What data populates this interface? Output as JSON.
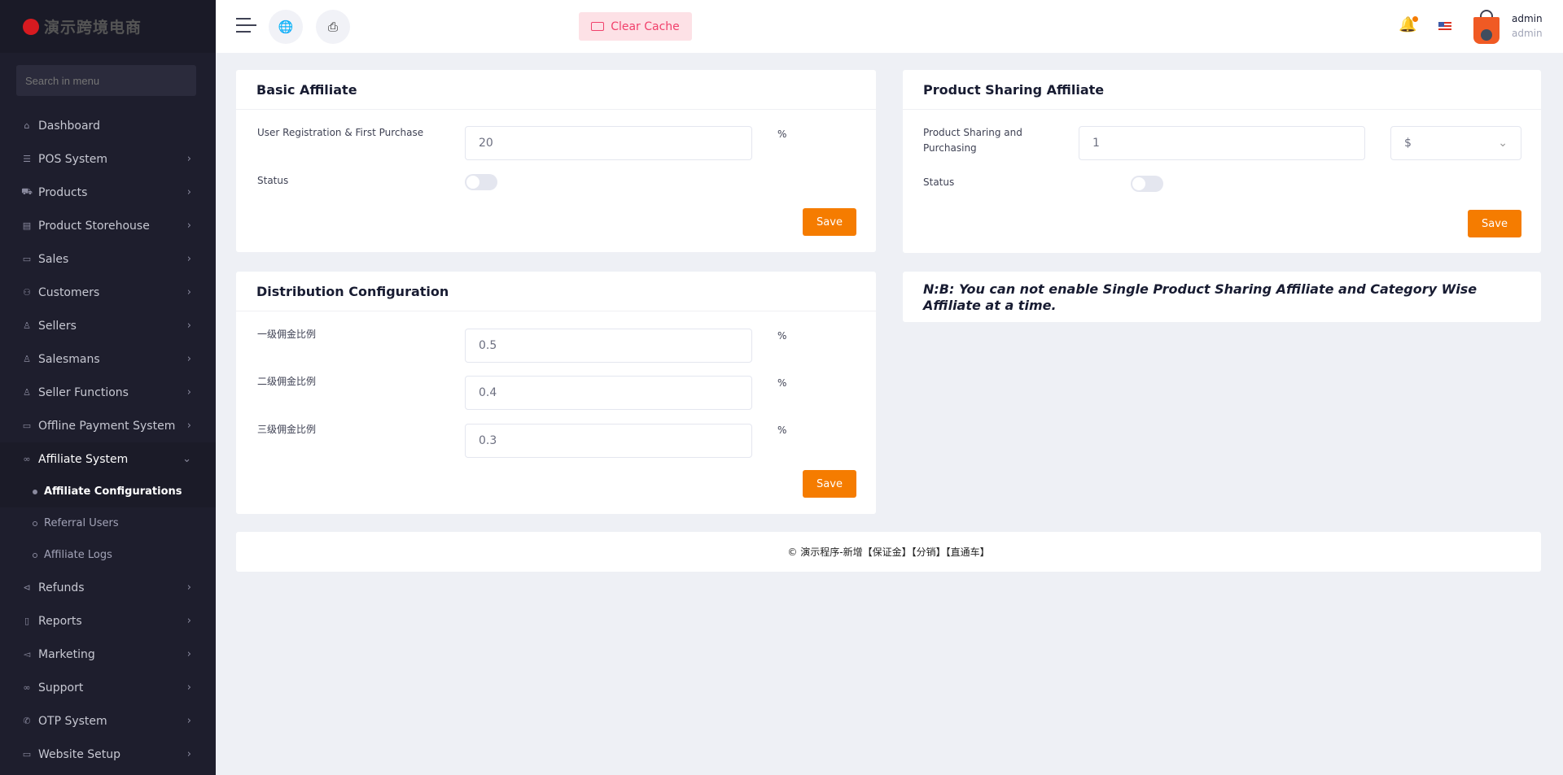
{
  "logo": {
    "text": "演示跨境电商"
  },
  "sidebar": {
    "search_placeholder": "Search in menu",
    "items": [
      {
        "label": "Dashboard"
      },
      {
        "label": "POS System"
      },
      {
        "label": "Products"
      },
      {
        "label": "Product Storehouse"
      },
      {
        "label": "Sales"
      },
      {
        "label": "Customers"
      },
      {
        "label": "Sellers"
      },
      {
        "label": "Salesmans"
      },
      {
        "label": "Seller Functions"
      },
      {
        "label": "Offline Payment System"
      },
      {
        "label": "Affiliate System"
      }
    ],
    "sub": [
      {
        "label": "Affiliate Configurations"
      },
      {
        "label": "Referral Users"
      },
      {
        "label": "Affiliate Logs"
      }
    ],
    "items2": [
      {
        "label": "Refunds"
      },
      {
        "label": "Reports"
      },
      {
        "label": "Marketing"
      },
      {
        "label": "Support"
      },
      {
        "label": "OTP System"
      },
      {
        "label": "Website Setup"
      }
    ]
  },
  "header": {
    "clear_cache": "Clear Cache",
    "user_name": "admin",
    "user_role": "admin"
  },
  "basic": {
    "title": "Basic Affiliate",
    "label": "User Registration & First Purchase",
    "value": "20",
    "unit": "%",
    "status": "Status",
    "status_on": false,
    "save": "Save"
  },
  "product": {
    "title": "Product Sharing Affiliate",
    "label": "Product Sharing and Purchasing",
    "value": "1",
    "currency": "$",
    "status": "Status",
    "status_on": false,
    "save": "Save"
  },
  "distribution": {
    "title": "Distribution Configuration",
    "rows": [
      {
        "label": "一级佣金比例",
        "value": "0.5",
        "unit": "%"
      },
      {
        "label": "二级佣金比例",
        "value": "0.4",
        "unit": "%"
      },
      {
        "label": "三级佣金比例",
        "value": "0.3",
        "unit": "%"
      }
    ],
    "save": "Save"
  },
  "note": "N:B: You can not enable Single Product Sharing Affiliate and Category Wise Affiliate at a time.",
  "footer": "© 演示程序-新增【保证金】【分销】【直通车】"
}
